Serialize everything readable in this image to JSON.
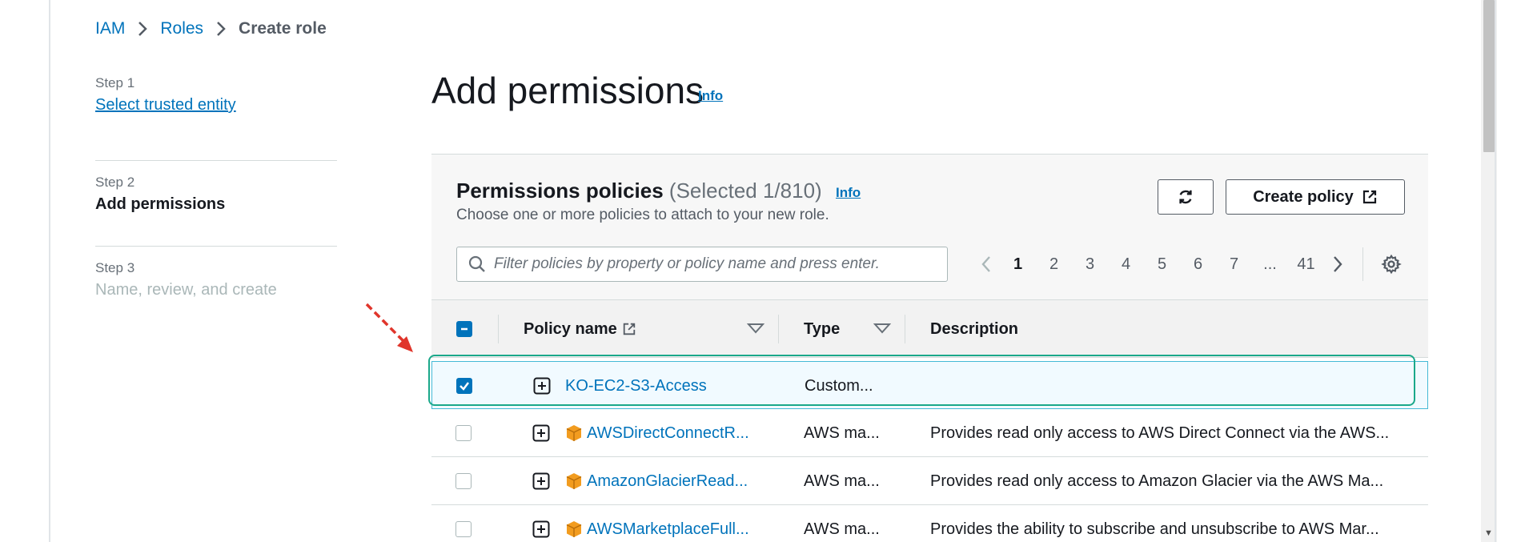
{
  "breadcrumb": {
    "items": [
      "IAM",
      "Roles"
    ],
    "current": "Create role"
  },
  "steps": [
    {
      "num": "Step 1",
      "title": "Select trusted entity"
    },
    {
      "num": "Step 2",
      "title": "Add permissions"
    },
    {
      "num": "Step 3",
      "title": "Name, review, and create"
    }
  ],
  "page": {
    "title": "Add permissions",
    "info": "Info"
  },
  "panel": {
    "title": "Permissions policies",
    "count": "(Selected 1/810)",
    "info": "Info",
    "description": "Choose one or more policies to attach to your new role.",
    "create_policy_label": "Create policy",
    "search_placeholder": "Filter policies by property or policy name and press enter."
  },
  "pagination": {
    "pages": [
      "1",
      "2",
      "3",
      "4",
      "5",
      "6",
      "7",
      "...",
      "41"
    ],
    "current": "1"
  },
  "table": {
    "columns": [
      "Policy name",
      "Type",
      "Description"
    ],
    "rows": [
      {
        "name": "KO-EC2-S3-Access",
        "type": "Custom...",
        "description": "",
        "checked": true
      },
      {
        "name": "AWSDirectConnectR...",
        "type": "AWS ma...",
        "description": "Provides read only access to AWS Direct Connect via the AWS...",
        "checked": false
      },
      {
        "name": "AmazonGlacierRead...",
        "type": "AWS ma...",
        "description": "Provides read only access to Amazon Glacier via the AWS Ma...",
        "checked": false
      },
      {
        "name": "AWSMarketplaceFull...",
        "type": "AWS ma...",
        "description": "Provides the ability to subscribe and unsubscribe to AWS Mar...",
        "checked": false
      }
    ]
  },
  "colors": {
    "link": "#0073bb",
    "highlight": "#1ba88a",
    "arrow": "#e0352b",
    "aws_orange": "#f29c1f"
  },
  "icons": [
    "chevron-right-icon",
    "refresh-icon",
    "external-link-icon",
    "search-icon",
    "chevron-left-icon",
    "settings-gear-icon",
    "sort-caret-icon",
    "expand-plus-icon",
    "aws-managed-box-icon",
    "checkbox-checked-icon",
    "checkbox-indeterminate-icon"
  ]
}
